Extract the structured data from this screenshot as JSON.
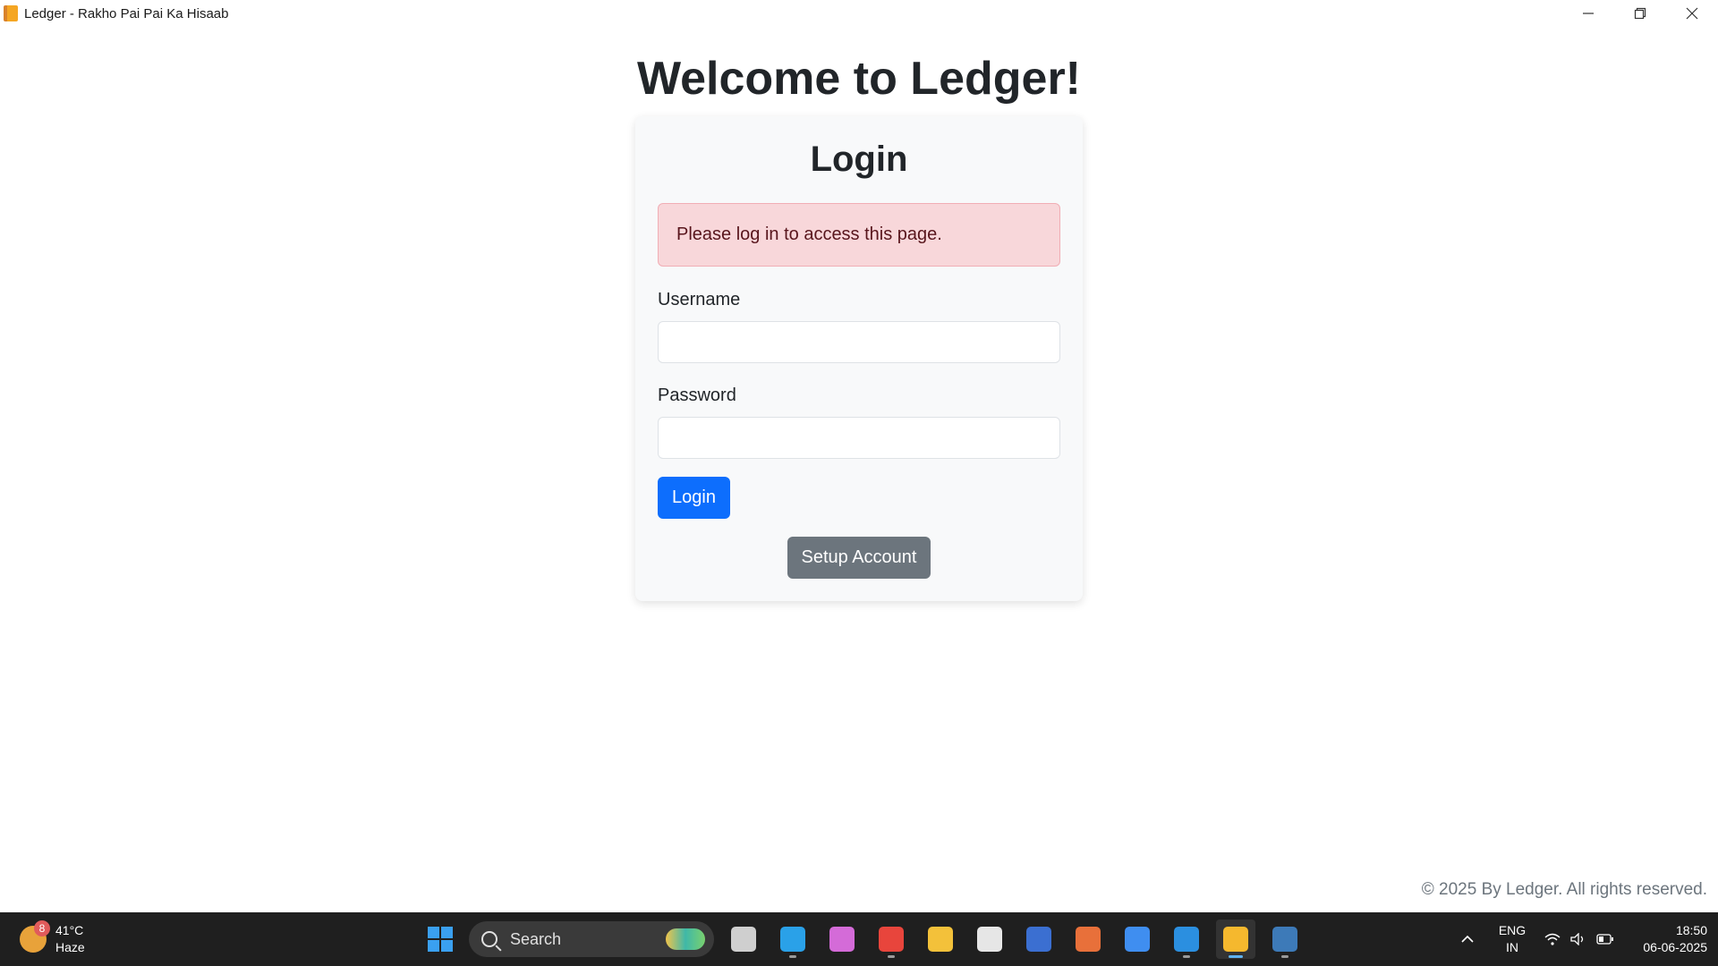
{
  "window": {
    "title": "Ledger - Rakho Pai Pai Ka Hisaab",
    "app_icon": "ledger-book-icon",
    "controls": [
      "minimize-icon",
      "restore-icon",
      "close-icon"
    ]
  },
  "page": {
    "heading": "Welcome to Ledger!"
  },
  "login_card": {
    "title": "Login",
    "alert": "Please log in to access this page.",
    "username_label": "Username",
    "username_value": "",
    "password_label": "Password",
    "password_value": "",
    "login_button": "Login",
    "setup_button": "Setup Account"
  },
  "footer": {
    "text": "© 2025 By Ledger. All rights reserved."
  },
  "taskbar": {
    "weather": {
      "temperature": "41°C",
      "condition": "Haze",
      "badge": "8",
      "icon": "weather-haze-icon"
    },
    "search_label": "Search",
    "apps": [
      {
        "name": "task-view-icon",
        "color": "#cfcfcf"
      },
      {
        "name": "edge-icon",
        "color": "#2aa1e8"
      },
      {
        "name": "copilot-icon",
        "color": "#d46bd8"
      },
      {
        "name": "chrome-icon",
        "color": "#e8453c"
      },
      {
        "name": "file-explorer-icon",
        "color": "#f3c13a"
      },
      {
        "name": "clock-app-icon",
        "color": "#e6e6e6"
      },
      {
        "name": "powershell-icon",
        "color": "#3b6fd1"
      },
      {
        "name": "git-icon",
        "color": "#e8703a"
      },
      {
        "name": "todo-icon",
        "color": "#3f8ef0"
      },
      {
        "name": "vscode-icon",
        "color": "#2b8fe0"
      },
      {
        "name": "ledger-app-icon",
        "color": "#f5b82e"
      },
      {
        "name": "python-icon",
        "color": "#3d7ab8"
      }
    ],
    "tray": {
      "language_line1": "ENG",
      "language_line2": "IN",
      "time": "18:50",
      "date": "06-06-2025"
    }
  },
  "colors": {
    "primary": "#0d6efd",
    "secondary": "#6c757d",
    "alert_bg": "#f8d7da",
    "alert_text": "#58151c",
    "card_bg": "#f8f9fa",
    "taskbar_bg": "#1f1f1f"
  }
}
